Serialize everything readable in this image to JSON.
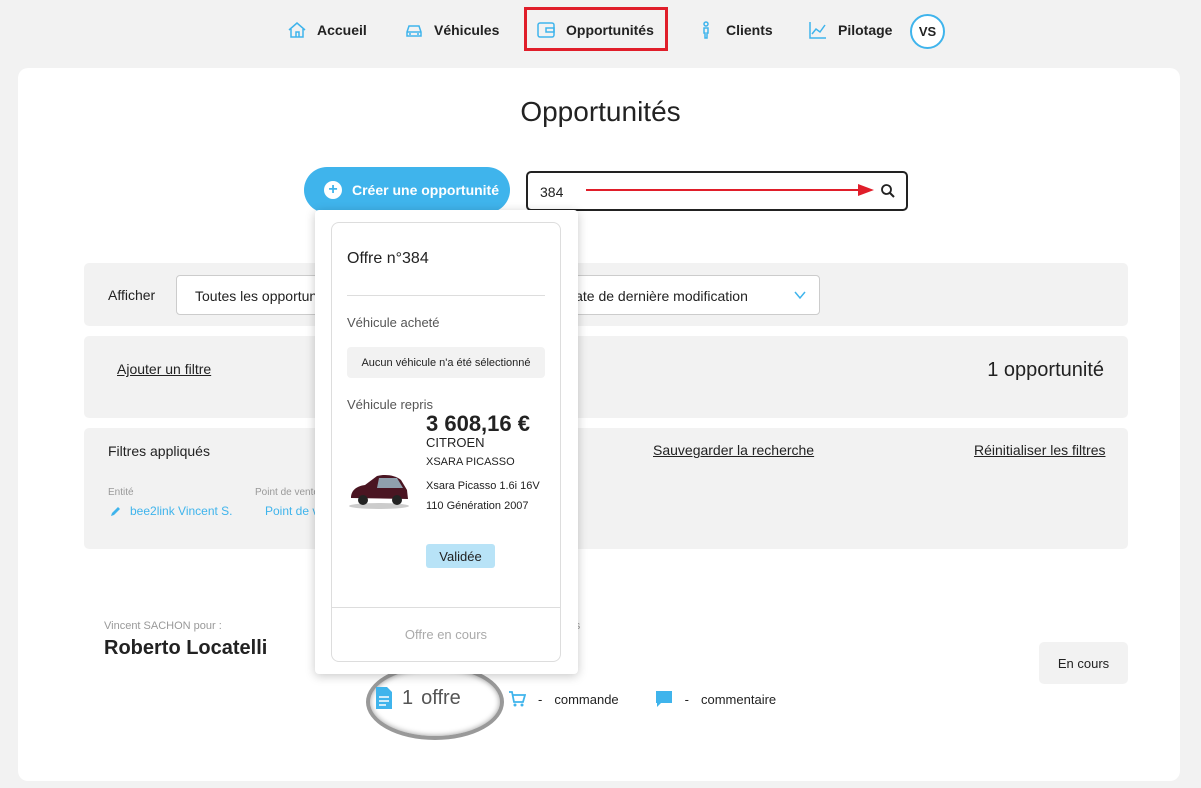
{
  "nav": {
    "items": [
      {
        "label": "Accueil",
        "icon": "home-icon"
      },
      {
        "label": "Véhicules",
        "icon": "car-icon"
      },
      {
        "label": "Opportunités",
        "icon": "wallet-icon"
      },
      {
        "label": "Clients",
        "icon": "person-icon"
      },
      {
        "label": "Pilotage",
        "icon": "chart-line-icon"
      }
    ],
    "avatar": "VS"
  },
  "page": {
    "title": "Opportunités"
  },
  "toolbar": {
    "create_label": "Créer une opportunité"
  },
  "search": {
    "value": "384"
  },
  "filters": {
    "afficher_label": "Afficher",
    "select_display": "Toutes les opportunités",
    "select_sort": "Date de dernière modification",
    "add_filter": "Ajouter un filtre",
    "count": "1 opportunité",
    "applied_title": "Filtres appliqués",
    "save_search": "Sauvegarder la recherche",
    "reset_filters": "Réinitialiser les filtres",
    "entity_label": "Entité",
    "entity_value": "bee2link Vincent S.",
    "pdv_label": "Point de vente",
    "pdv_value": "Point de vente"
  },
  "opportunity": {
    "by_line": "Vincent SACHON pour :",
    "client_name": "Roberto Locatelli",
    "right_fragment": "urs",
    "status": "En cours",
    "offer_count": "1",
    "offer_label": "offre",
    "commande": "commande",
    "commentaire": "commentaire",
    "dash": "-"
  },
  "popup": {
    "title": "Offre n°384",
    "bought_label": "Véhicule acheté",
    "no_vehicle": "Aucun véhicule n'a été sélectionné",
    "trade_label": "Véhicule repris",
    "price": "3 608,16 €",
    "brand": "CITROEN",
    "model": "XSARA PICASSO",
    "description": "Xsara Picasso 1.6i 16V 110 Génération 2007",
    "badge": "Validée",
    "footer": "Offre en cours"
  },
  "colors": {
    "accent": "#3fb4ec",
    "highlight": "#e01e2a"
  }
}
